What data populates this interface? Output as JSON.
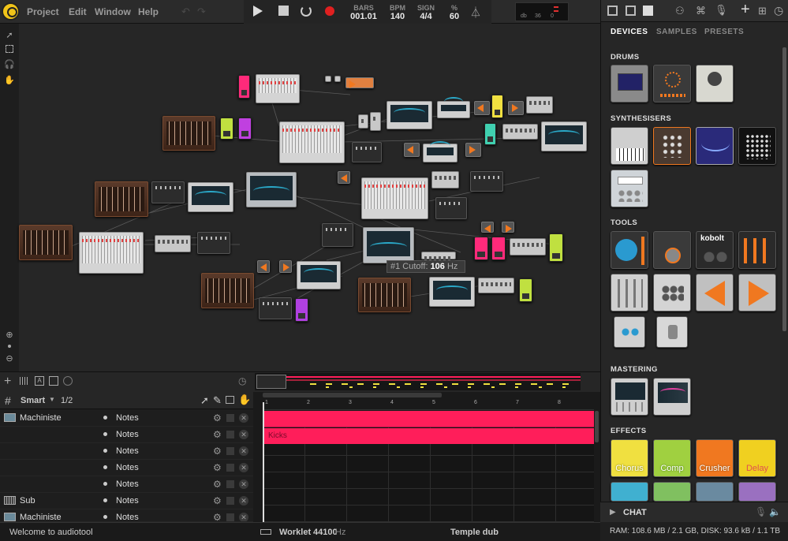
{
  "menu": {
    "project": "Project",
    "edit": "Edit",
    "window": "Window",
    "help": "Help"
  },
  "transport": {
    "bars_label": "BARS",
    "bars_value": "001.01",
    "bpm_label": "BPM",
    "bpm_value": "140",
    "sign_label": "SIGN",
    "sign_value": "4/4",
    "pct_label": "%",
    "pct_value": "60",
    "meter_scale": [
      "db",
      "36",
      "0"
    ]
  },
  "tooltip": {
    "param": "#1 Cutoff:",
    "value": "106",
    "unit": "Hz"
  },
  "timeline": {
    "smart_label": "Smart",
    "page": "1/2",
    "clip_label": "Kicks",
    "ruler": [
      "1",
      "2",
      "3",
      "4",
      "5",
      "6",
      "7",
      "8"
    ]
  },
  "tracks": [
    {
      "name": "Machiniste",
      "notes": "Notes"
    },
    {
      "name": "",
      "notes": "Notes"
    },
    {
      "name": "",
      "notes": "Notes"
    },
    {
      "name": "",
      "notes": "Notes"
    },
    {
      "name": "",
      "notes": "Notes"
    },
    {
      "name": "Sub",
      "notes": "Notes"
    },
    {
      "name": "Machiniste",
      "notes": "Notes"
    }
  ],
  "status": {
    "welcome": "Welcome to audiotool",
    "engine": "Worklet",
    "rate": "44100",
    "rate_unit": "Hz",
    "song": "Temple dub"
  },
  "panel": {
    "tabs": [
      "DEVICES",
      "SAMPLES",
      "PRESETS"
    ],
    "sections": {
      "drums": "DRUMS",
      "synths": "SYNTHESISERS",
      "tools": "TOOLS",
      "mastering": "MASTERING",
      "effects": "EFFECTS"
    },
    "tools_kobolt": "kobolt",
    "effects": [
      "Chorus",
      "Comp",
      "Crusher",
      "Delay"
    ],
    "chat": "CHAT",
    "resources": "RAM: 108.6 MB / 2.1 GB, DISK: 93.6 kB / 1.1 TB"
  },
  "colors": {
    "accent": "#f0c419",
    "clip": "#ff1e5a",
    "chorus": "#f0e040",
    "comp": "#a0d040",
    "crusher": "#f07820",
    "delay": "#f0d020"
  }
}
